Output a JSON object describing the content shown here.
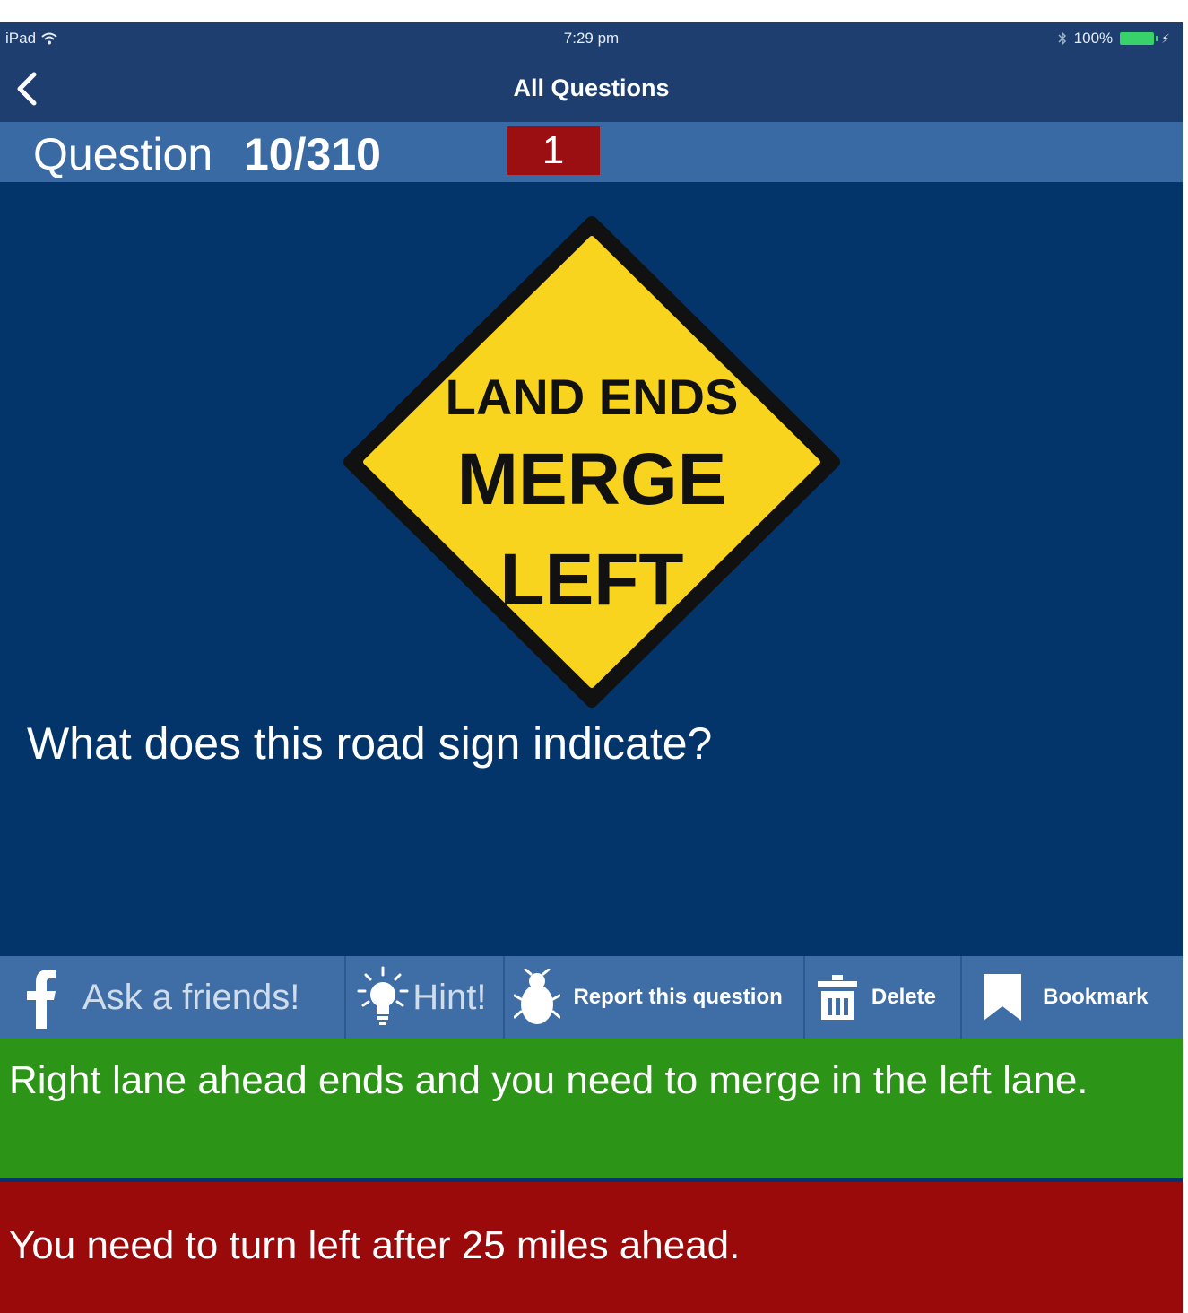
{
  "status_bar": {
    "device": "iPad",
    "time": "7:29 pm",
    "battery": "100%"
  },
  "nav": {
    "title": "All Questions",
    "back_icon": "chevron-left-icon"
  },
  "question_header": {
    "label": "Question",
    "number": "10/310",
    "badge": "1"
  },
  "sign": {
    "line1": "LAND ENDS",
    "line2": "MERGE",
    "line3": "LEFT",
    "colors": {
      "fill": "#f9d41f",
      "border": "#111111"
    }
  },
  "question": {
    "text": "What does this road sign indicate?"
  },
  "toolbar": {
    "ask_label": "Ask a friends!",
    "hint_label": "Hint!",
    "report_label": "Report this question",
    "delete_label": "Delete",
    "bookmark_label": "Bookmark"
  },
  "answers": {
    "correct": "Right lane ahead ends and you need to merge in the left lane.",
    "wrong": "You need to turn left after 25 miles ahead."
  },
  "colors": {
    "background": "#04356a",
    "header": "#3a6aa4",
    "badge": "#9b0f12",
    "correct": "#2c9417",
    "wrong": "#9b0a0b"
  }
}
